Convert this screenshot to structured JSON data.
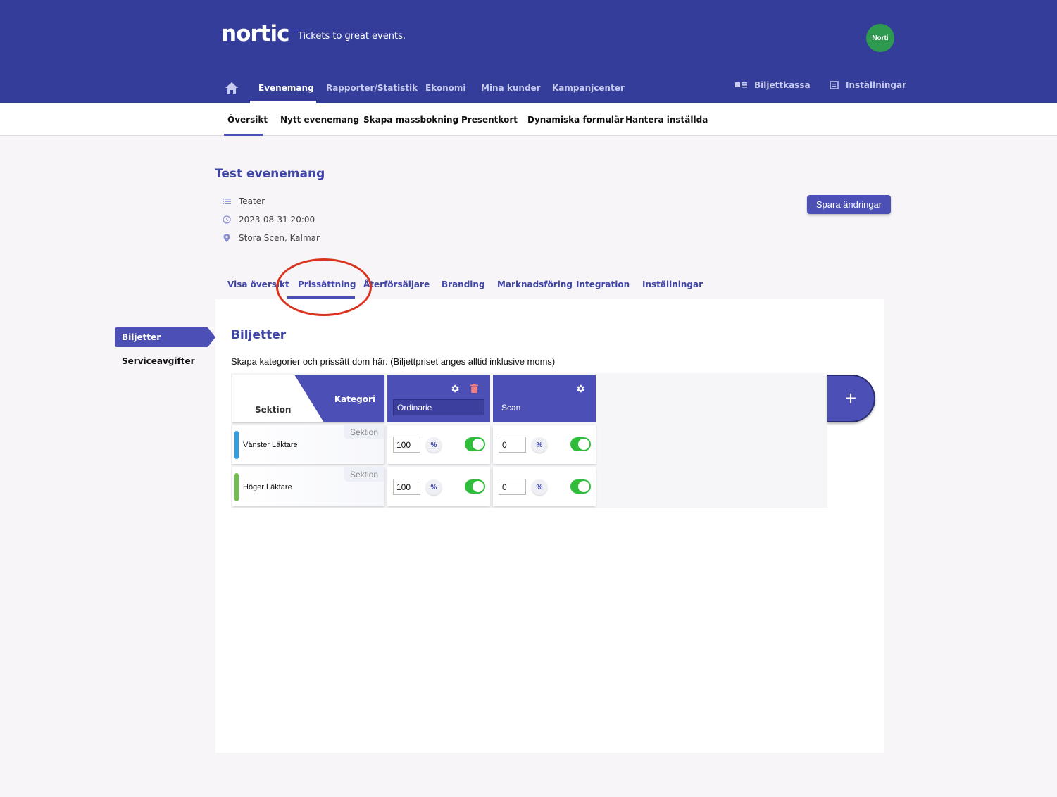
{
  "header": {
    "logo": "nortic",
    "tagline": "Tickets to great events.",
    "avatar": "Norti",
    "nav": [
      {
        "label": "Evenemang"
      },
      {
        "label": "Rapporter/Statistik"
      },
      {
        "label": "Ekonomi"
      },
      {
        "label": "Mina kunder"
      },
      {
        "label": "Kampanjcenter"
      }
    ],
    "right_nav": [
      {
        "label": "Biljettkassa",
        "icon": "cash-register-icon"
      },
      {
        "label": "Inställningar",
        "icon": "settings-icon"
      }
    ]
  },
  "subnav": [
    "Översikt",
    "Nytt evenemang",
    "Skapa massbokning",
    "Presentkort",
    "Dynamiska formulär",
    "Hantera inställda"
  ],
  "event": {
    "title": "Test evenemang",
    "category": "Teater",
    "datetime": "2023-08-31 20:00",
    "venue": "Stora Scen, Kalmar",
    "save_label": "Spara ändringar"
  },
  "event_tabs": [
    "Visa översikt",
    "Prissättning",
    "Återförsäljare",
    "Branding",
    "Marknadsföring",
    "Integration",
    "Inställningar"
  ],
  "sidebar": [
    "Biljetter",
    "Serviceavgifter"
  ],
  "pricing": {
    "title": "Biljetter",
    "description": "Skapa kategorier och prissätt dom här. (Biljettpriset anges alltid inklusive moms)",
    "corner": {
      "category_label": "Kategori",
      "section_label": "Sektion"
    },
    "categories": [
      "Ordinarie",
      "Scan"
    ],
    "section_tag": "Sektion",
    "rows": [
      {
        "name": "Vänster Läktare",
        "color": "#2f9fe0",
        "prices": [
          "100",
          "0"
        ],
        "percent": "%"
      },
      {
        "name": "Höger Läktare",
        "color": "#6fbf4a",
        "prices": [
          "100",
          "0"
        ],
        "percent": "%"
      }
    ],
    "add_label": "+"
  },
  "colors": {
    "brand": "#343d99",
    "accent": "#4c4fb6",
    "toggle_on": "#2fbd3b",
    "annotation": "#d9341f"
  }
}
